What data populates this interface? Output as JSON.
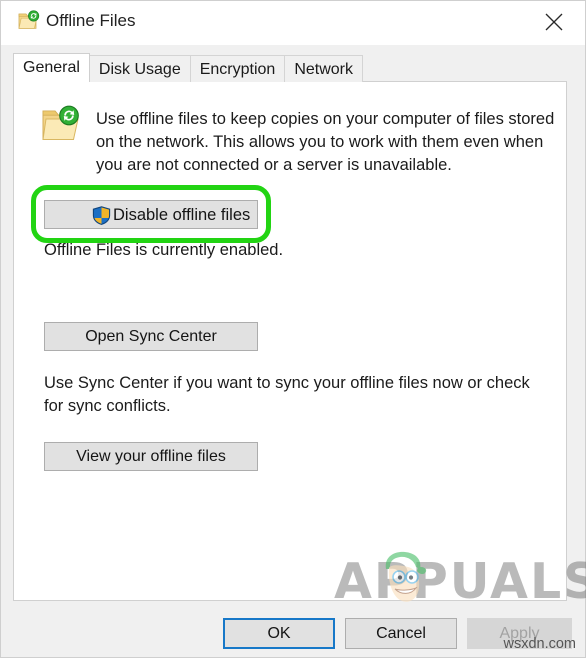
{
  "window": {
    "title": "Offline Files",
    "title_icon": "offline-folder-sync-icon",
    "close_icon": "close-icon"
  },
  "tabs": [
    {
      "label": "General",
      "active": true
    },
    {
      "label": "Disk Usage",
      "active": false
    },
    {
      "label": "Encryption",
      "active": false
    },
    {
      "label": "Network",
      "active": false
    }
  ],
  "general_tab": {
    "intro_icon": "offline-folder-sync-icon",
    "intro_text": "Use offline files to keep copies on your computer of files stored on the network.  This allows you to work with them even when you are not connected or a server is unavailable.",
    "disable_button": {
      "label": "Disable offline files",
      "icon": "uac-shield-icon",
      "highlighted": true,
      "highlight_color": "#22d413"
    },
    "status_text": "Offline Files is currently enabled.",
    "sync_center_button": {
      "label": "Open Sync Center"
    },
    "sync_description": "Use Sync Center if you want to sync your offline files now or check for sync conflicts.",
    "view_files_button": {
      "label": "View your offline files"
    }
  },
  "footer": {
    "ok_label": "OK",
    "cancel_label": "Cancel",
    "apply_label": "Apply",
    "apply_disabled": true,
    "ok_focus_color": "#1778c8"
  },
  "watermarks": {
    "brand": "APPUALS",
    "domain": "wsxdn.com"
  }
}
